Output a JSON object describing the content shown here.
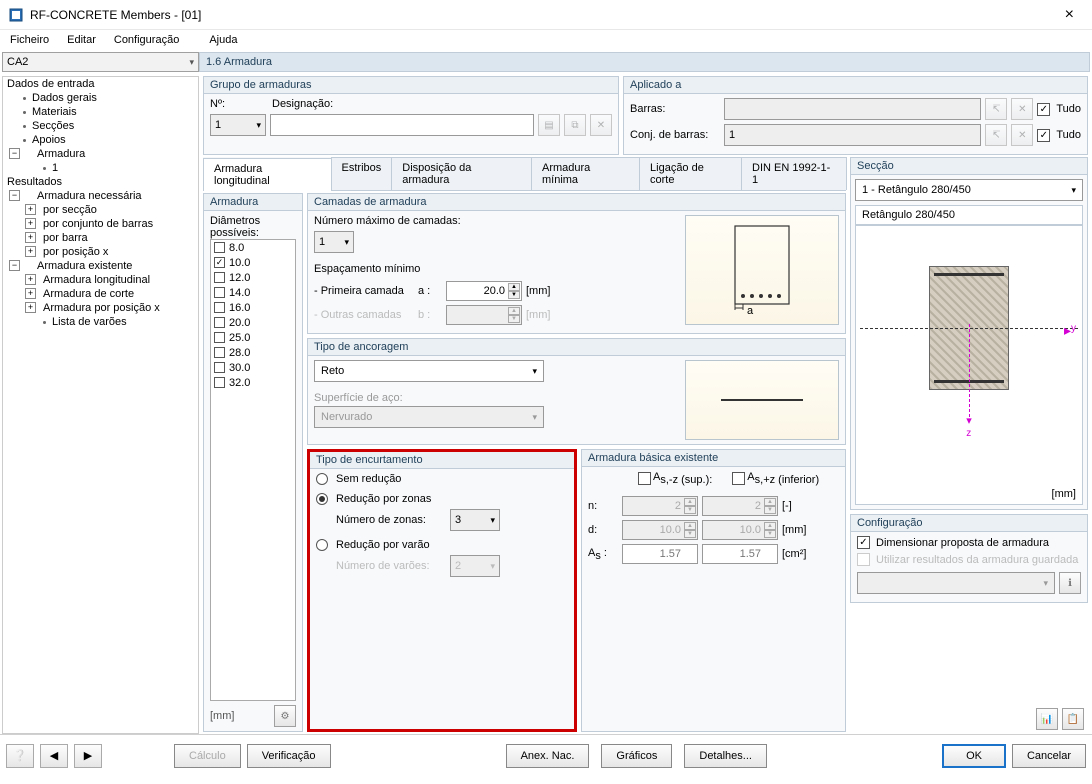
{
  "window": {
    "title": "RF-CONCRETE Members - [01]",
    "close": "×"
  },
  "menu": {
    "file": "Ficheiro",
    "edit": "Editar",
    "config": "Configuração",
    "help": "Ajuda"
  },
  "top": {
    "combo": "CA2",
    "heading": "1.6 Armadura"
  },
  "tree": {
    "dados": "Dados de entrada",
    "gerais": "Dados gerais",
    "materiais": "Materiais",
    "seccoes": "Secções",
    "apoios": "Apoios",
    "armadura": "Armadura",
    "a1": "1",
    "resultados": "Resultados",
    "necessaria": "Armadura necessária",
    "porsec": "por secção",
    "porconj": "por conjunto de barras",
    "porbar": "por barra",
    "porpos": "por posição x",
    "existente": "Armadura existente",
    "along": "Armadura longitudinal",
    "acorte": "Armadura de corte",
    "aporposx": "Armadura por posição x",
    "listavar": "Lista de varões"
  },
  "grp": {
    "armaduras": "Grupo de armaduras",
    "no": "Nº:",
    "design": "Designação:",
    "novalue": "1",
    "aplicado": "Aplicado a",
    "barras": "Barras:",
    "conj": "Conj. de barras:",
    "conjval": "1",
    "tudo": "Tudo"
  },
  "tabs": {
    "t1": "Armadura longitudinal",
    "t2": "Estribos",
    "t3": "Disposição da armadura",
    "t4": "Armadura mínima",
    "t5": "Ligação de corte",
    "t6": "DIN EN 1992-1-1"
  },
  "arm": {
    "head": "Armadura",
    "diam": "Diâmetros possíveis:",
    "list": [
      "8.0",
      "10.0",
      "12.0",
      "14.0",
      "16.0",
      "20.0",
      "25.0",
      "28.0",
      "30.0",
      "32.0"
    ],
    "checked": "10.0",
    "mm": "[mm]"
  },
  "camadas": {
    "head": "Camadas de armadura",
    "max": "Número máximo de camadas:",
    "maxv": "1",
    "espac": "Espaçamento mínimo",
    "prim": "- Primeira camada",
    "out": "- Outras camadas",
    "a": "a :",
    "b": "b :",
    "av": "20.0",
    "mm": "[mm]",
    "alabel": "a"
  },
  "anc": {
    "head": "Tipo de ancoragem",
    "val": "Reto",
    "surf": "Superfície de aço:",
    "surfval": "Nervurado"
  },
  "enc": {
    "head": "Tipo de encurtamento",
    "r1": "Sem redução",
    "r2": "Redução por zonas",
    "nz": "Número de zonas:",
    "nzv": "3",
    "r3": "Redução por varão",
    "nv": "Número de varões:",
    "nvv": "2"
  },
  "bas": {
    "head": "Armadura básica existente",
    "sup": "A",
    "supsub": "s,-z (sup.):",
    "inf": "A",
    "infsub": "s,+z (inferior)",
    "n": "n:",
    "d": "d:",
    "as": "A",
    "assub": "s",
    "col1n": "2",
    "col2n": "2",
    "col1d": "10.0",
    "col2d": "10.0",
    "col1as": "1.57",
    "col2as": "1.57",
    "u_n": "[-]",
    "u_d": "[mm]",
    "u_as": "[cm²]"
  },
  "sec": {
    "head": "Secção",
    "sel": "1 - Retângulo 280/450",
    "name": "Retângulo 280/450",
    "mm": "[mm]"
  },
  "cfg": {
    "head": "Configuração",
    "c1": "Dimensionar proposta de armadura",
    "c2": "Utilizar resultados da armadura guardada"
  },
  "footer": {
    "calc": "Cálculo",
    "verif": "Verificação",
    "anex": "Anex. Nac.",
    "graf": "Gráficos",
    "det": "Detalhes...",
    "ok": "OK",
    "cancel": "Cancelar"
  }
}
